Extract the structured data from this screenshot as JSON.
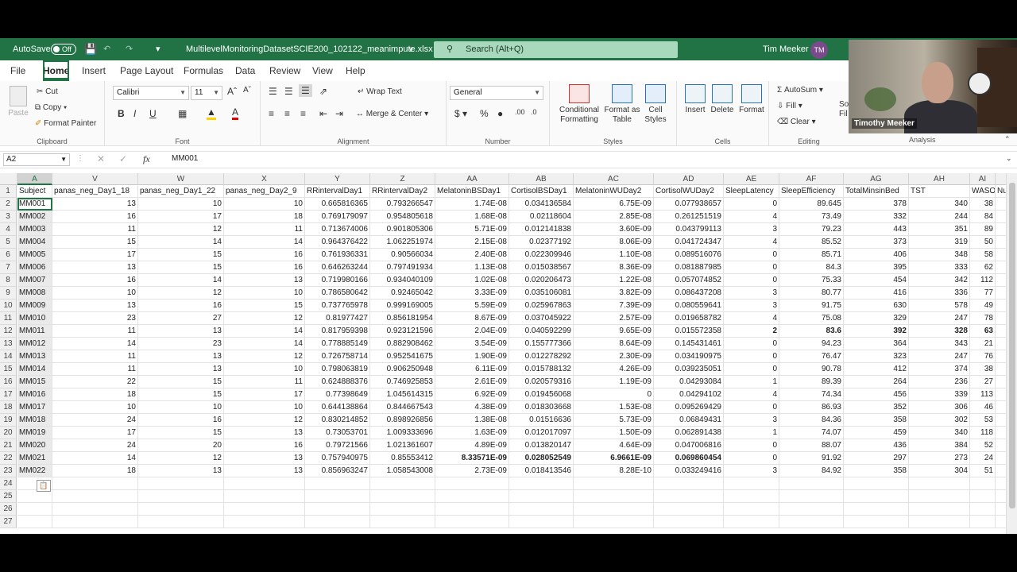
{
  "title": {
    "autosave_label": "AutoSave",
    "autosave_state": "Off",
    "filename": "MultilevelMonitoringDatasetSCIE200_102122_meanimpute.xlsx",
    "search_placeholder": "Search (Alt+Q)",
    "user_name": "Tim Meeker",
    "user_initials": "TM"
  },
  "tabs": [
    "File",
    "Home",
    "Insert",
    "Page Layout",
    "Formulas",
    "Data",
    "Review",
    "View",
    "Help"
  ],
  "ribbon": {
    "clipboard": {
      "paste": "Paste",
      "cut": "Cut",
      "copy": "Copy",
      "format_painter": "Format Painter",
      "label": "Clipboard"
    },
    "font": {
      "name": "Calibri",
      "size": "11",
      "label": "Font"
    },
    "alignment": {
      "wrap": "Wrap Text",
      "merge": "Merge & Center",
      "label": "Alignment"
    },
    "number": {
      "format": "General",
      "label": "Number"
    },
    "styles": {
      "cond1": "Conditional",
      "cond2": "Formatting",
      "fmt1": "Format as",
      "fmt2": "Table",
      "cell1": "Cell",
      "cell2": "Styles",
      "label": "Styles"
    },
    "cells": {
      "insert": "Insert",
      "delete": "Delete",
      "format": "Format",
      "label": "Cells"
    },
    "editing": {
      "autosum": "AutoSum",
      "fill": "Fill",
      "clear": "Clear",
      "sort1": "So",
      "sort2": "Fil",
      "label": "Editing"
    },
    "analysis": {
      "label": "Analysis"
    }
  },
  "webcam": {
    "name": "Timothy Meeker"
  },
  "formula_bar": {
    "namebox": "A2",
    "fx": "fx",
    "value": "MM001"
  },
  "columns": [
    "A",
    "V",
    "W",
    "X",
    "Y",
    "Z",
    "AA",
    "AB",
    "AC",
    "AD",
    "AE",
    "AF",
    "AG",
    "AH",
    "AI",
    ""
  ],
  "row_numbers": [
    "1",
    "2",
    "3",
    "4",
    "5",
    "6",
    "7",
    "8",
    "9",
    "10",
    "11",
    "12",
    "13",
    "14",
    "15",
    "16",
    "17",
    "18",
    "19",
    "20",
    "21",
    "22",
    "23",
    "24",
    "25",
    "26",
    "27"
  ],
  "headers": [
    "Subject",
    "panas_neg_Day1_18",
    "panas_neg_Day1_22",
    "panas_neg_Day2_9",
    "RRintervalDay1",
    "RRintervalDay2",
    "MelatoninBSDay1",
    "CortisolBSDay1",
    "MelatoninWUDay2",
    "CortisolWUDay2",
    "SleepLatency",
    "SleepEfficiency",
    "TotalMinsinBed",
    "TST",
    "WASO",
    "Nu"
  ],
  "rows": [
    [
      "MM001",
      "13",
      "10",
      "10",
      "0.665816365",
      "0.793266547",
      "1.74E-08",
      "0.034136584",
      "6.75E-09",
      "0.077938657",
      "0",
      "89.645",
      "378",
      "340",
      "38"
    ],
    [
      "MM002",
      "16",
      "17",
      "18",
      "0.769179097",
      "0.954805618",
      "1.68E-08",
      "0.02118604",
      "2.85E-08",
      "0.261251519",
      "4",
      "73.49",
      "332",
      "244",
      "84"
    ],
    [
      "MM003",
      "11",
      "12",
      "11",
      "0.713674006",
      "0.901805306",
      "5.71E-09",
      "0.012141838",
      "3.60E-09",
      "0.043799113",
      "3",
      "79.23",
      "443",
      "351",
      "89"
    ],
    [
      "MM004",
      "15",
      "14",
      "14",
      "0.964376422",
      "1.062251974",
      "2.15E-08",
      "0.02377192",
      "8.06E-09",
      "0.041724347",
      "4",
      "85.52",
      "373",
      "319",
      "50"
    ],
    [
      "MM005",
      "17",
      "15",
      "16",
      "0.761936331",
      "0.90566034",
      "2.40E-08",
      "0.022309946",
      "1.10E-08",
      "0.089516076",
      "0",
      "85.71",
      "406",
      "348",
      "58"
    ],
    [
      "MM006",
      "13",
      "15",
      "16",
      "0.646263244",
      "0.797491934",
      "1.13E-08",
      "0.015038567",
      "8.36E-09",
      "0.081887985",
      "0",
      "84.3",
      "395",
      "333",
      "62"
    ],
    [
      "MM007",
      "16",
      "14",
      "13",
      "0.719980166",
      "0.934040109",
      "1.02E-08",
      "0.020206473",
      "1.22E-08",
      "0.057074852",
      "0",
      "75.33",
      "454",
      "342",
      "112"
    ],
    [
      "MM008",
      "10",
      "12",
      "10",
      "0.786580642",
      "0.92465042",
      "3.33E-09",
      "0.035106081",
      "3.82E-09",
      "0.086437208",
      "3",
      "80.77",
      "416",
      "336",
      "77"
    ],
    [
      "MM009",
      "13",
      "16",
      "15",
      "0.737765978",
      "0.999169005",
      "5.59E-09",
      "0.025967863",
      "7.39E-09",
      "0.080559641",
      "3",
      "91.75",
      "630",
      "578",
      "49"
    ],
    [
      "MM010",
      "23",
      "27",
      "12",
      "0.81977427",
      "0.856181954",
      "8.67E-09",
      "0.037045922",
      "2.57E-09",
      "0.019658782",
      "4",
      "75.08",
      "329",
      "247",
      "78"
    ],
    [
      "MM011",
      "11",
      "13",
      "14",
      "0.817959398",
      "0.923121596",
      "2.04E-09",
      "0.040592299",
      "9.65E-09",
      "0.015572358",
      "2",
      "83.6",
      "392",
      "328",
      "63"
    ],
    [
      "MM012",
      "14",
      "23",
      "14",
      "0.778885149",
      "0.882908462",
      "3.54E-09",
      "0.155777366",
      "8.64E-09",
      "0.145431461",
      "0",
      "94.23",
      "364",
      "343",
      "21"
    ],
    [
      "MM013",
      "11",
      "13",
      "12",
      "0.726758714",
      "0.952541675",
      "1.90E-09",
      "0.012278292",
      "2.30E-09",
      "0.034190975",
      "0",
      "76.47",
      "323",
      "247",
      "76"
    ],
    [
      "MM014",
      "11",
      "13",
      "10",
      "0.798063819",
      "0.906250948",
      "6.11E-09",
      "0.015788132",
      "4.26E-09",
      "0.039235051",
      "0",
      "90.78",
      "412",
      "374",
      "38"
    ],
    [
      "MM015",
      "22",
      "15",
      "11",
      "0.624888376",
      "0.746925853",
      "2.61E-09",
      "0.020579316",
      "1.19E-09",
      "0.04293084",
      "1",
      "89.39",
      "264",
      "236",
      "27"
    ],
    [
      "MM016",
      "18",
      "15",
      "17",
      "0.77398649",
      "1.045614315",
      "6.92E-09",
      "0.019456068",
      "0",
      "0.04294102",
      "4",
      "74.34",
      "456",
      "339",
      "113"
    ],
    [
      "MM017",
      "10",
      "10",
      "10",
      "0.644138864",
      "0.844667543",
      "4.38E-09",
      "0.018303668",
      "1.53E-08",
      "0.095269429",
      "0",
      "86.93",
      "352",
      "306",
      "46"
    ],
    [
      "MM018",
      "24",
      "16",
      "12",
      "0.830214852",
      "0.898926856",
      "1.38E-08",
      "0.01516636",
      "5.73E-09",
      "0.06849431",
      "3",
      "84.36",
      "358",
      "302",
      "53"
    ],
    [
      "MM019",
      "17",
      "15",
      "13",
      "0.73053701",
      "1.009333696",
      "1.63E-09",
      "0.012017097",
      "1.50E-09",
      "0.062891438",
      "1",
      "74.07",
      "459",
      "340",
      "118"
    ],
    [
      "MM020",
      "24",
      "20",
      "16",
      "0.79721566",
      "1.021361607",
      "4.89E-09",
      "0.013820147",
      "4.64E-09",
      "0.047006816",
      "0",
      "88.07",
      "436",
      "384",
      "52"
    ],
    [
      "MM021",
      "14",
      "12",
      "13",
      "0.757940975",
      "0.85553412",
      "8.33571E-09",
      "0.028052549",
      "6.9661E-09",
      "0.069860454",
      "0",
      "91.92",
      "297",
      "273",
      "24"
    ],
    [
      "MM022",
      "18",
      "13",
      "13",
      "0.856963247",
      "1.058543008",
      "2.73E-09",
      "0.018413546",
      "8.28E-10",
      "0.033249416",
      "3",
      "84.92",
      "358",
      "304",
      "51"
    ]
  ]
}
